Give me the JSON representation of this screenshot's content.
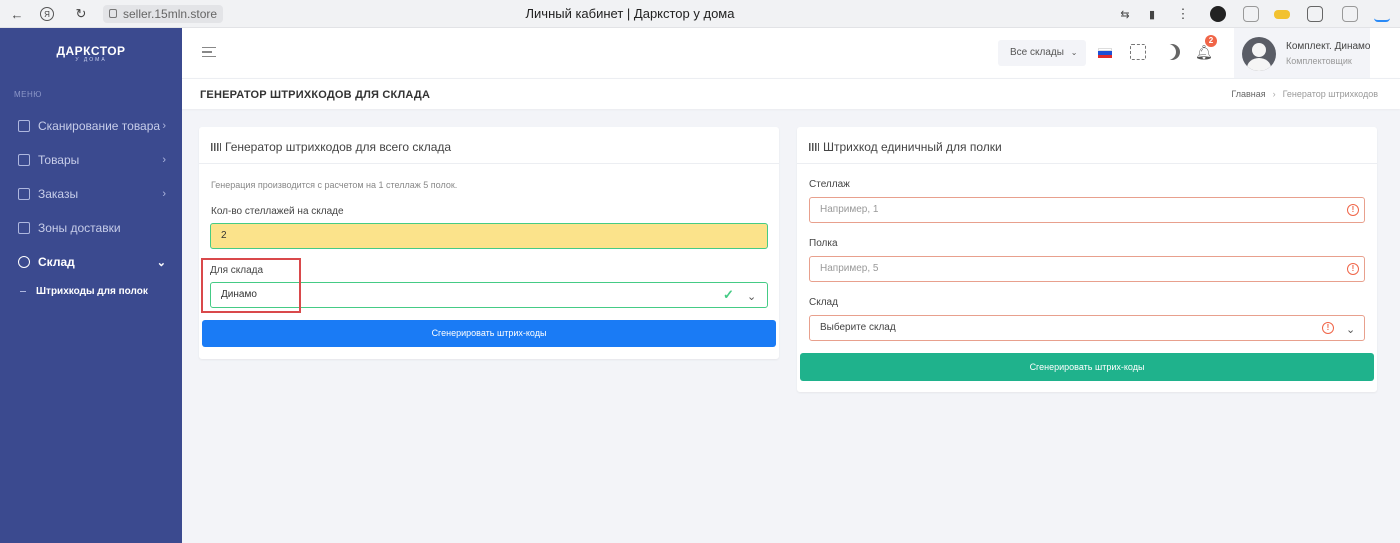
{
  "browser": {
    "url": "seller.15mln.store",
    "tab_title": "Личный кабинет | Даркстор у дома"
  },
  "sidebar": {
    "logo": "ДАРКСТОР",
    "logo_sub": "У ДОМА",
    "menu_title": "МЕНЮ",
    "items": [
      {
        "label": "Сканирование товара",
        "icon": "scan-icon"
      },
      {
        "label": "Товары",
        "icon": "grid-icon"
      },
      {
        "label": "Заказы",
        "icon": "table-icon"
      },
      {
        "label": "Зоны доставки",
        "icon": "map-zones-icon"
      },
      {
        "label": "Склад",
        "icon": "location-pin-icon"
      }
    ],
    "sub_item": "Штрихкоды для полок"
  },
  "topbar": {
    "warehouse_select": "Все склады",
    "notifications_count": "2",
    "user_name": "Комплект. Динамо",
    "user_role": "Комплектовщик"
  },
  "page": {
    "title": "ГЕНЕРАТОР ШТРИХКОДОВ ДЛЯ СКЛАДА",
    "breadcrumb_home": "Главная",
    "breadcrumb_current": "Генератор штрихкодов"
  },
  "card_left": {
    "title": "Генератор штрихкодов для всего склада",
    "hint": "Генерация производится с расчетом на 1 стеллаж 5 полок.",
    "racks_label": "Кол-во стеллажей на складе",
    "racks_value": "2",
    "warehouse_label": "Для склада",
    "warehouse_value": "Динамо",
    "button": "Сгенерировать штрих-коды"
  },
  "card_right": {
    "title": "Штрихкод единичный для полки",
    "rack_label": "Стеллаж",
    "rack_placeholder": "Например, 1",
    "shelf_label": "Полка",
    "shelf_placeholder": "Например, 5",
    "warehouse_label": "Склад",
    "warehouse_placeholder": "Выберите склад",
    "button": "Сгенерировать штрих-коды"
  },
  "colors": {
    "sidebar": "#3b4a8f",
    "primary": "#1a7bf5",
    "success": "#1fb28c",
    "error": "#f06548",
    "highlight": "#d9494b"
  }
}
